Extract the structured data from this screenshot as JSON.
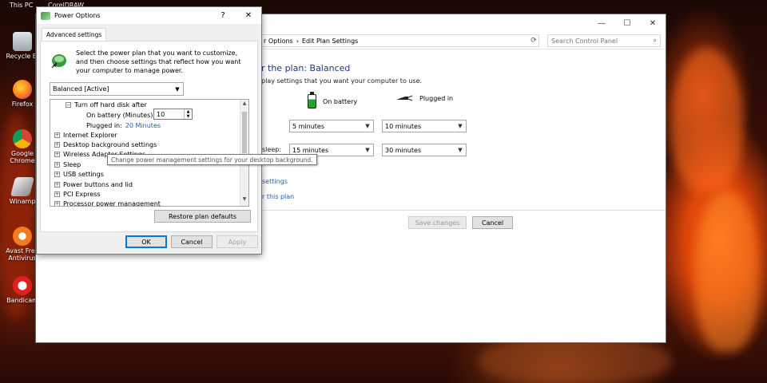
{
  "desktop": {
    "top_labels": [
      "This PC",
      "CorelDRAW"
    ],
    "icons": [
      {
        "label": "Recycle Bi",
        "icon": "recycle-bin-icon",
        "color": "#cfd8dc"
      },
      {
        "label": "Firefox",
        "icon": "firefox-icon",
        "color": "#ff7a1a"
      },
      {
        "label": "Google Chrome",
        "icon": "chrome-icon",
        "color": "#2e9d4a"
      },
      {
        "label": "Winamp",
        "icon": "winamp-icon",
        "color": "#d9d9d9"
      },
      {
        "label": "Avast Free Antivirus",
        "icon": "avast-icon",
        "color": "#f47a20"
      },
      {
        "label": "Bandicam",
        "icon": "bandicam-icon",
        "color": "#e02020"
      }
    ]
  },
  "control_panel": {
    "breadcrumb": [
      "r Options",
      "Edit Plan Settings"
    ],
    "search_placeholder": "Search Control Panel",
    "heading": "r the plan: Balanced",
    "subheading": "play settings that you want your computer to use.",
    "col_on_battery": "On battery",
    "col_plugged_in": "Plugged in",
    "row_sleep_label": "sleep:",
    "display_on_battery": "5 minutes",
    "display_plugged_in": "10 minutes",
    "sleep_on_battery": "15 minutes",
    "sleep_plugged_in": "30 minutes",
    "link_settings": "settings",
    "link_plan": "r this plan",
    "save_changes": "Save changes",
    "cancel": "Cancel"
  },
  "power_options": {
    "title": "Power Options",
    "help_glyph": "?",
    "close_glyph": "✕",
    "tab": "Advanced settings",
    "intro": "Select the power plan that you want to customize, and then choose settings that reflect how you want your computer to manage power.",
    "plan_selected": "Balanced [Active]",
    "tree": {
      "hard_disk": "Turn off hard disk after",
      "on_battery_label": "On battery (Minutes):",
      "on_battery_value": "10",
      "plugged_in_label": "Plugged in:",
      "plugged_in_value": "20 Minutes",
      "items": [
        "Internet Explorer",
        "Desktop background settings",
        "Wireless Adapter Settings",
        "Sleep",
        "USB settings",
        "Power buttons and lid",
        "PCI Express",
        "Processor power management"
      ]
    },
    "tooltip": "Change power management settings for your desktop background.",
    "restore": "Restore plan defaults",
    "ok": "OK",
    "cancel": "Cancel",
    "apply": "Apply"
  }
}
